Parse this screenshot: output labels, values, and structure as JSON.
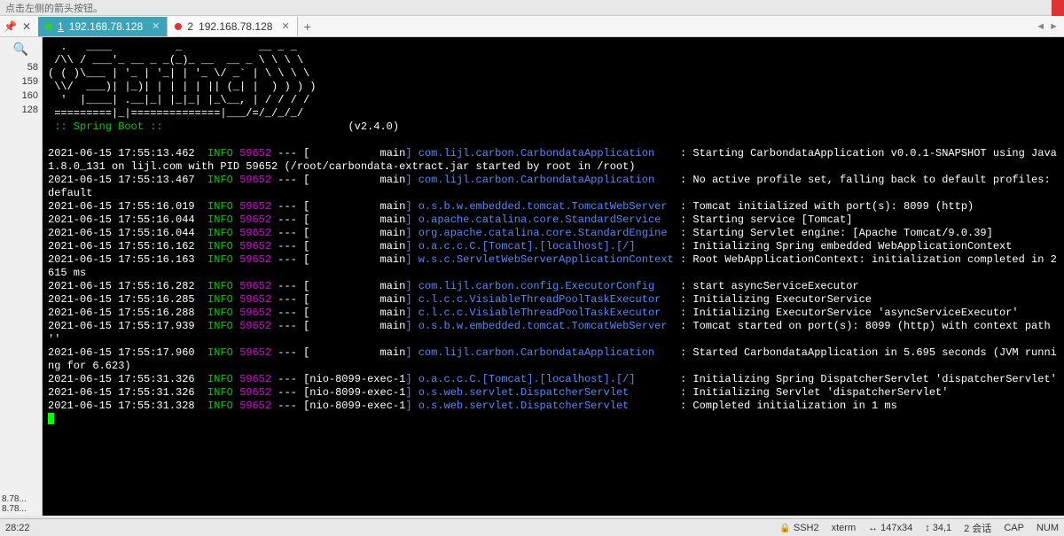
{
  "topbar": {
    "hint": "点击左侧的箭头按钮。"
  },
  "tabs": {
    "pin_icon": "📌",
    "close_all": "✕",
    "items": [
      {
        "num": "1",
        "label": "192.168.78.128",
        "active": true,
        "dot": "green"
      },
      {
        "num": "2",
        "label": "192.168.78.128",
        "active": false,
        "dot": "red"
      }
    ],
    "new_tab": "+",
    "nav_prev": "◄",
    "nav_next": "►"
  },
  "left_rail": {
    "search": "🔍",
    "entries": [
      "58",
      "159",
      "160",
      "128"
    ],
    "sessions": [
      "8.78...",
      "8.78..."
    ]
  },
  "terminal": {
    "ascii": [
      "  .   ____          _            __ _ _",
      " /\\\\ / ___'_ __ _ _(_)_ __  __ _ \\ \\ \\ \\",
      "( ( )\\___ | '_ | '_| | '_ \\/ _` | \\ \\ \\ \\",
      " \\\\/  ___)| |_)| | | | | || (_| |  ) ) ) )",
      "  '  |____| .__|_| |_|_| |_\\__, | / / / /",
      " =========|_|==============|___/=/_/_/_/"
    ],
    "spring_label": " :: Spring Boot :: ",
    "spring_version": "(v2.4.0)",
    "logs": [
      {
        "ts": "2021-06-15 17:55:13.462",
        "lvl": "INFO",
        "pid": "59652",
        "thr": "main",
        "logger": "com.lijl.carbon.CarbondataApplication",
        "msg": "Starting CarbondataApplication v0.0.1-SNAPSHOT using Java 1.8.0_131 on lijl.com with PID 59652 (/root/carbondata-extract.jar started by root in /root)"
      },
      {
        "ts": "2021-06-15 17:55:13.467",
        "lvl": "INFO",
        "pid": "59652",
        "thr": "main",
        "logger": "com.lijl.carbon.CarbondataApplication",
        "msg": "No active profile set, falling back to default profiles: default"
      },
      {
        "ts": "2021-06-15 17:55:16.019",
        "lvl": "INFO",
        "pid": "59652",
        "thr": "main",
        "logger": "o.s.b.w.embedded.tomcat.TomcatWebServer",
        "msg": "Tomcat initialized with port(s): 8099 (http)"
      },
      {
        "ts": "2021-06-15 17:55:16.044",
        "lvl": "INFO",
        "pid": "59652",
        "thr": "main",
        "logger": "o.apache.catalina.core.StandardService",
        "msg": "Starting service [Tomcat]"
      },
      {
        "ts": "2021-06-15 17:55:16.044",
        "lvl": "INFO",
        "pid": "59652",
        "thr": "main",
        "logger": "org.apache.catalina.core.StandardEngine",
        "msg": "Starting Servlet engine: [Apache Tomcat/9.0.39]"
      },
      {
        "ts": "2021-06-15 17:55:16.162",
        "lvl": "INFO",
        "pid": "59652",
        "thr": "main",
        "logger": "o.a.c.c.C.[Tomcat].[localhost].[/]",
        "msg": "Initializing Spring embedded WebApplicationContext"
      },
      {
        "ts": "2021-06-15 17:55:16.163",
        "lvl": "INFO",
        "pid": "59652",
        "thr": "main",
        "logger": "w.s.c.ServletWebServerApplicationContext",
        "msg": "Root WebApplicationContext: initialization completed in 2615 ms"
      },
      {
        "ts": "2021-06-15 17:55:16.282",
        "lvl": "INFO",
        "pid": "59652",
        "thr": "main",
        "logger": "com.lijl.carbon.config.ExecutorConfig",
        "msg": "start asyncServiceExecutor"
      },
      {
        "ts": "2021-06-15 17:55:16.285",
        "lvl": "INFO",
        "pid": "59652",
        "thr": "main",
        "logger": "c.l.c.c.VisiableThreadPoolTaskExecutor",
        "msg": "Initializing ExecutorService"
      },
      {
        "ts": "2021-06-15 17:55:16.288",
        "lvl": "INFO",
        "pid": "59652",
        "thr": "main",
        "logger": "c.l.c.c.VisiableThreadPoolTaskExecutor",
        "msg": "Initializing ExecutorService 'asyncServiceExecutor'"
      },
      {
        "ts": "2021-06-15 17:55:17.939",
        "lvl": "INFO",
        "pid": "59652",
        "thr": "main",
        "logger": "o.s.b.w.embedded.tomcat.TomcatWebServer",
        "msg": "Tomcat started on port(s): 8099 (http) with context path ''"
      },
      {
        "ts": "2021-06-15 17:55:17.960",
        "lvl": "INFO",
        "pid": "59652",
        "thr": "main",
        "logger": "com.lijl.carbon.CarbondataApplication",
        "msg": "Started CarbondataApplication in 5.695 seconds (JVM running for 6.623)"
      },
      {
        "ts": "2021-06-15 17:55:31.326",
        "lvl": "INFO",
        "pid": "59652",
        "thr": "nio-8099-exec-1",
        "logger": "o.a.c.c.C.[Tomcat].[localhost].[/]",
        "msg": "Initializing Spring DispatcherServlet 'dispatcherServlet'"
      },
      {
        "ts": "2021-06-15 17:55:31.326",
        "lvl": "INFO",
        "pid": "59652",
        "thr": "nio-8099-exec-1",
        "logger": "o.s.web.servlet.DispatcherServlet",
        "msg": "Initializing Servlet 'dispatcherServlet'"
      },
      {
        "ts": "2021-06-15 17:55:31.328",
        "lvl": "INFO",
        "pid": "59652",
        "thr": "nio-8099-exec-1",
        "logger": "o.s.web.servlet.DispatcherServlet",
        "msg": "Completed initialization in 1 ms"
      }
    ]
  },
  "statusbar": {
    "time": "28:22",
    "ssh": "SSH2",
    "term": "xterm",
    "size": "147x34",
    "pos": "34,1",
    "sess": "2 会话",
    "caps": "CAP",
    "num": "NUM",
    "size_icon": "↔",
    "pos_icon": "↕"
  }
}
